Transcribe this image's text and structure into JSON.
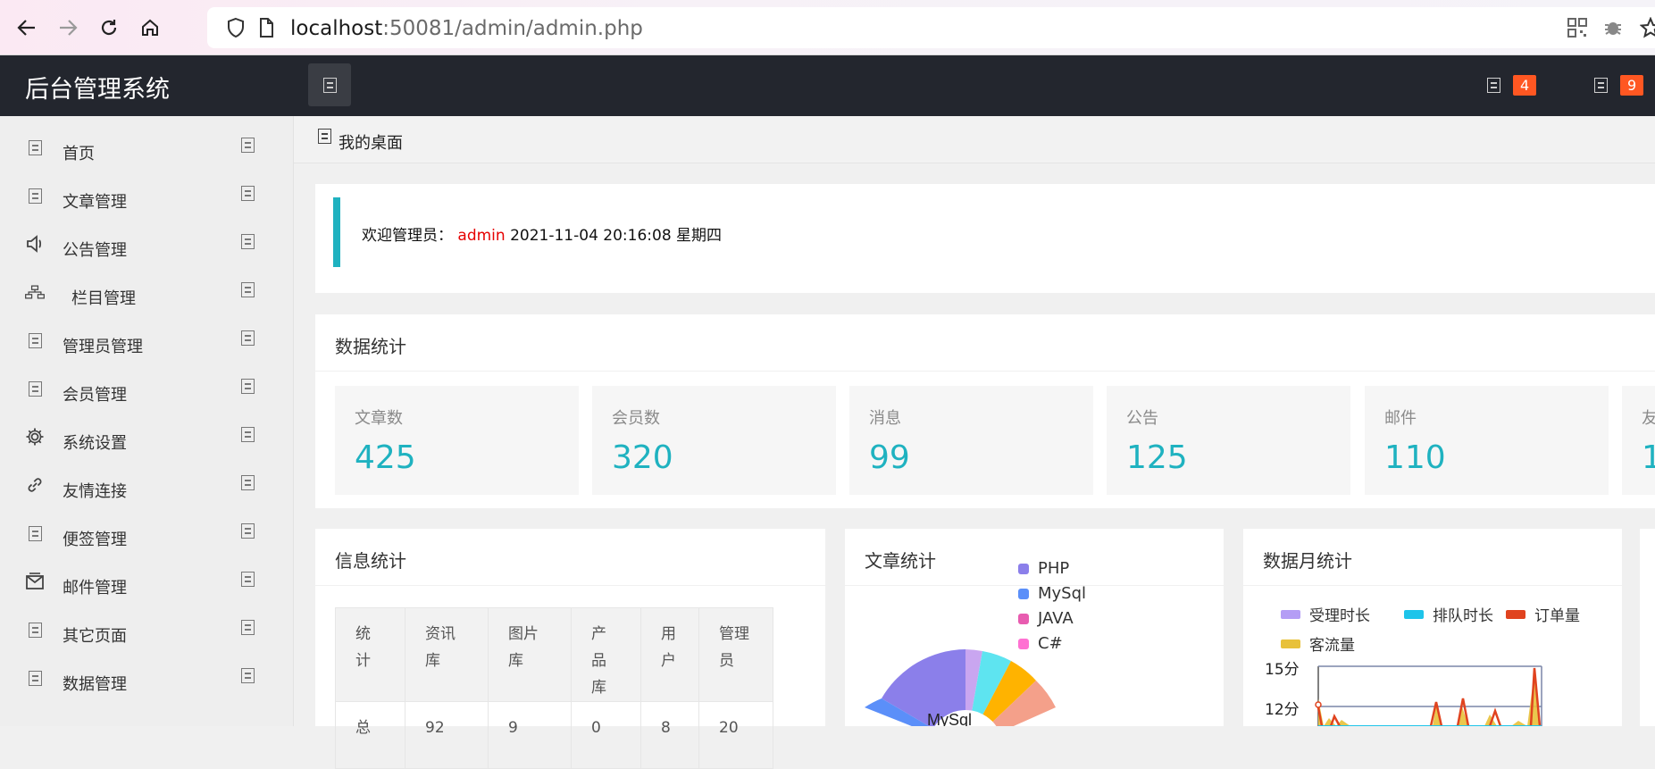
{
  "browser": {
    "url_host": "localhost",
    "url_rest": ":50081/admin/admin.php"
  },
  "header": {
    "app_title": "后台管理系统",
    "notifications": [
      {
        "count": "4"
      },
      {
        "count": "9"
      }
    ]
  },
  "sidebar": {
    "items": [
      {
        "label": "首页",
        "icon": "home-icon"
      },
      {
        "label": "文章管理",
        "icon": "article-icon"
      },
      {
        "label": "公告管理",
        "icon": "speaker-icon"
      },
      {
        "label": "栏目管理",
        "icon": "sitemap-icon"
      },
      {
        "label": "管理员管理",
        "icon": "admin-icon"
      },
      {
        "label": "会员管理",
        "icon": "member-icon"
      },
      {
        "label": "系统设置",
        "icon": "gear-icon"
      },
      {
        "label": "友情连接",
        "icon": "link-icon"
      },
      {
        "label": "便签管理",
        "icon": "note-icon"
      },
      {
        "label": "邮件管理",
        "icon": "mail-icon"
      },
      {
        "label": "其它页面",
        "icon": "page-icon"
      },
      {
        "label": "数据管理",
        "icon": "data-icon"
      }
    ]
  },
  "tab": {
    "label": "我的桌面"
  },
  "welcome": {
    "prefix": "欢迎管理员：",
    "user": "admin",
    "datetime": "2021-11-04  20:16:08  星期四"
  },
  "stats": {
    "title": "数据统计",
    "items": [
      {
        "label": "文章数",
        "value": "425"
      },
      {
        "label": "会员数",
        "value": "320"
      },
      {
        "label": "消息",
        "value": "99"
      },
      {
        "label": "公告",
        "value": "125"
      },
      {
        "label": "邮件",
        "value": "110"
      },
      {
        "label": "友",
        "value": "1"
      }
    ]
  },
  "info": {
    "title": "信息统计",
    "headers": [
      "统\n计",
      "资讯\n库",
      "图片\n库",
      "产品\n库",
      "用\n户",
      "管理\n员"
    ],
    "row": [
      "总",
      "92",
      "9",
      "0",
      "8",
      "20"
    ]
  },
  "articles": {
    "title": "文章统计",
    "legend": [
      "PHP",
      "MySql",
      "JAVA",
      "C#"
    ],
    "colors": [
      "#8b7fea",
      "#5b8ff9",
      "#e85cb0",
      "#ff71d2"
    ],
    "visible_label": "MySql"
  },
  "monthly": {
    "title": "数据月统计",
    "legend": [
      "受理时长",
      "排队时长",
      "订单量",
      "客流量"
    ],
    "colors": [
      "#b49df5",
      "#1ec4ea",
      "#e0431f",
      "#e8c13a"
    ],
    "y_ticks": [
      "15分",
      "12分"
    ]
  }
}
